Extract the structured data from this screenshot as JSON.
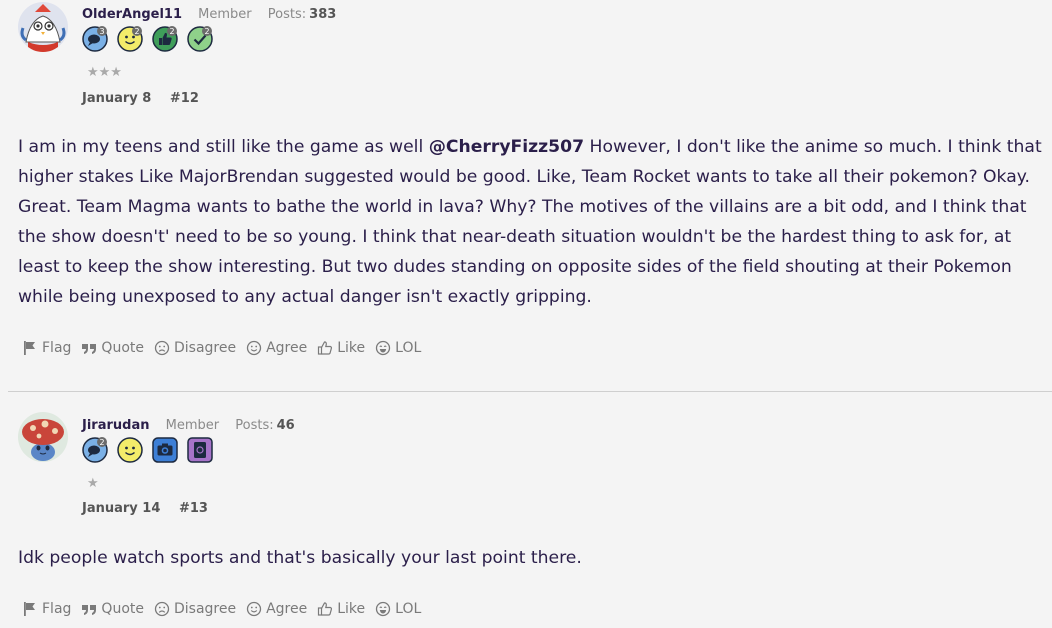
{
  "posts": [
    {
      "username": "OlderAngel11",
      "role": "Member",
      "posts_label": "Posts:",
      "posts_count": "383",
      "stars": "★★★",
      "date": "January 8",
      "post_number": "#12",
      "badges": [
        {
          "icon": "speech-bubble-badge-icon",
          "level": "3"
        },
        {
          "icon": "smiley-badge-icon",
          "level": "2"
        },
        {
          "icon": "thumbs-up-badge-icon",
          "level": "2"
        },
        {
          "icon": "checkmark-badge-icon",
          "level": "2"
        }
      ],
      "body": {
        "text_before": "I am in my teens and still like the game as well ",
        "mention": "@CherryFizz507",
        "text_after": " However, I don't like the anime so much. I think that higher stakes Like MajorBrendan suggested would be good. Like, Team Rocket wants to take all their pokemon? Okay. Great. Team Magma wants to bathe the world in lava? Why? The motives of the villains are a bit odd, and I think that the show doesn't' need to be so young. I think that near-death situation wouldn't be the hardest thing to ask for, at least to keep the show interesting. But two dudes standing on opposite sides of the field shouting at their Pokemon while being unexposed to any actual danger isn't exactly gripping."
      }
    },
    {
      "username": "Jirarudan",
      "role": "Member",
      "posts_label": "Posts:",
      "posts_count": "46",
      "stars": "★",
      "date": "January 14",
      "post_number": "#13",
      "badges": [
        {
          "icon": "speech-bubble-badge-icon",
          "level": "2"
        },
        {
          "icon": "smiley-badge-icon",
          "level": ""
        },
        {
          "icon": "camera-badge-icon",
          "level": ""
        },
        {
          "icon": "card-badge-icon",
          "level": ""
        }
      ],
      "body": {
        "text": "Idk people watch sports and that's basically your last point there."
      }
    }
  ],
  "actions": {
    "flag": "Flag",
    "quote": "Quote",
    "disagree": "Disagree",
    "agree": "Agree",
    "like": "Like",
    "lol": "LOL"
  },
  "colors": {
    "background": "#f4f4f4",
    "text": "#2b1f4a",
    "muted": "#8a8a8a",
    "action": "#7a7a7a"
  }
}
